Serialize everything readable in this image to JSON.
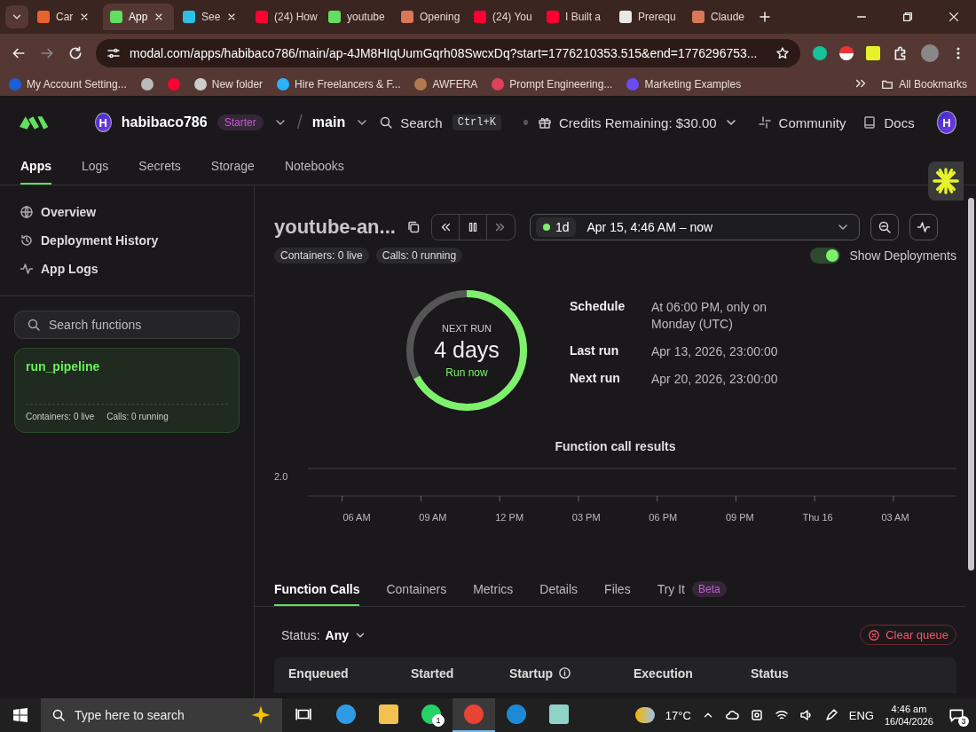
{
  "browser": {
    "tabs": [
      {
        "title": "Car",
        "selected": false,
        "color": "#e8632b"
      },
      {
        "title": "App",
        "selected": true,
        "color": "#62de61"
      },
      {
        "title": "See",
        "selected": false,
        "color": "#2bc0e4"
      },
      {
        "title": "(24) How",
        "selected": false,
        "color": "#ff0033"
      },
      {
        "title": "youtube",
        "selected": false,
        "color": "#62de61"
      },
      {
        "title": "Opening",
        "selected": false,
        "color": "#d97757"
      },
      {
        "title": "(24) You",
        "selected": false,
        "color": "#ff0033"
      },
      {
        "title": "I Built a",
        "selected": false,
        "color": "#ff0033"
      },
      {
        "title": "Prerequ",
        "selected": false,
        "color": "#e8e8e8"
      },
      {
        "title": "Claude",
        "selected": false,
        "color": "#d97757"
      }
    ],
    "url": "modal.com/apps/habibaco786/main/ap-4JM8HIqUumGqrh08SwcxDq?start=1776210353.515&end=1776296753...",
    "bookmarks": [
      {
        "label": "My Account Setting...",
        "color": "#1a5fd6"
      },
      {
        "color": "#bbbbbb"
      },
      {
        "color": "#ff0033"
      },
      {
        "label": "New folder",
        "color": "#cccccc"
      },
      {
        "label": "Hire Freelancers & F...",
        "color": "#29b2fe"
      },
      {
        "label": "AWFERA",
        "color": "#b07a50"
      },
      {
        "label": "Prompt Engineering...",
        "color": "#e0405a"
      },
      {
        "label": "Marketing Examples",
        "color": "#6a4cf0"
      }
    ],
    "all_bookmarks": "All Bookmarks"
  },
  "header": {
    "workspace_initial": "H",
    "workspace": "habibaco786",
    "plan": "Starter",
    "separator": "/",
    "environment": "main",
    "search": "Search",
    "shortcut": "Ctrl+K",
    "credits": "Credits Remaining: $30.00",
    "links": [
      "Community",
      "Docs"
    ],
    "user_initial": "H"
  },
  "nav": [
    {
      "label": "Apps",
      "selected": true
    },
    {
      "label": "Logs",
      "selected": false
    },
    {
      "label": "Secrets",
      "selected": false
    },
    {
      "label": "Storage",
      "selected": false
    },
    {
      "label": "Notebooks",
      "selected": false
    }
  ],
  "sidebar": {
    "items": [
      {
        "label": "Overview"
      },
      {
        "label": "Deployment History"
      },
      {
        "label": "App Logs"
      }
    ],
    "search": {
      "placeholder": "Search functions"
    },
    "functions": [
      {
        "name": "run_pipeline",
        "containers": "Containers: 0 live",
        "calls": "Calls: 0 running"
      }
    ]
  },
  "app": {
    "title": "youtube-an...",
    "chips": [
      {
        "label": "Containers:",
        "value": "0 live"
      },
      {
        "label": "Calls:",
        "value": "0 running"
      }
    ],
    "range": {
      "period": "1d",
      "text": "Apr 15, 4:46 AM – now"
    },
    "toggle": {
      "label": "Show Deployments",
      "on": true
    },
    "next_run": {
      "label": "NEXT RUN",
      "value": "4 days",
      "action": "Run now",
      "level": 0.67
    },
    "details": [
      {
        "label": "Schedule",
        "value": "At 06:00 PM, only on Monday (UTC)"
      },
      {
        "label": "Last run",
        "value": "Apr 13, 2026, 23:00:00"
      },
      {
        "label": "Next run",
        "value": "Apr 20, 2026, 23:00:00"
      }
    ],
    "chart": {
      "title": "Function call results",
      "y_label": "2.0",
      "x_labels": [
        "06 AM",
        "09 AM",
        "12 PM",
        "03 PM",
        "06 PM",
        "09 PM",
        "Thu 16",
        "03 AM"
      ]
    },
    "tabs": [
      {
        "label": "Function Calls",
        "selected": true
      },
      {
        "label": "Containers",
        "selected": false
      },
      {
        "label": "Metrics",
        "selected": false
      },
      {
        "label": "Details",
        "selected": false
      },
      {
        "label": "Files",
        "selected": false
      },
      {
        "label": "Try It",
        "badge": "Beta",
        "selected": false
      }
    ],
    "filter": {
      "label": "Status:",
      "value": "Any"
    },
    "clear": "Clear queue",
    "columns": [
      "Enqueued",
      "Started",
      "Startup",
      "Execution",
      "Status"
    ]
  },
  "taskbar": {
    "search": {
      "placeholder": "Type here to search"
    },
    "apps": [
      {
        "color": "#2f9be6",
        "active": false
      },
      {
        "color": "#f2c14e",
        "active": false
      },
      {
        "color": "#25d366",
        "active": false,
        "badge": "1"
      },
      {
        "color": "#e84335",
        "active": true
      },
      {
        "color": "#1e8ad6",
        "active": false
      },
      {
        "color": "#8fd3c8",
        "active": false
      }
    ],
    "weather": "17°C",
    "language": "ENG",
    "time": "4:46 am",
    "date": "16/04/2026",
    "notifications": "3"
  }
}
